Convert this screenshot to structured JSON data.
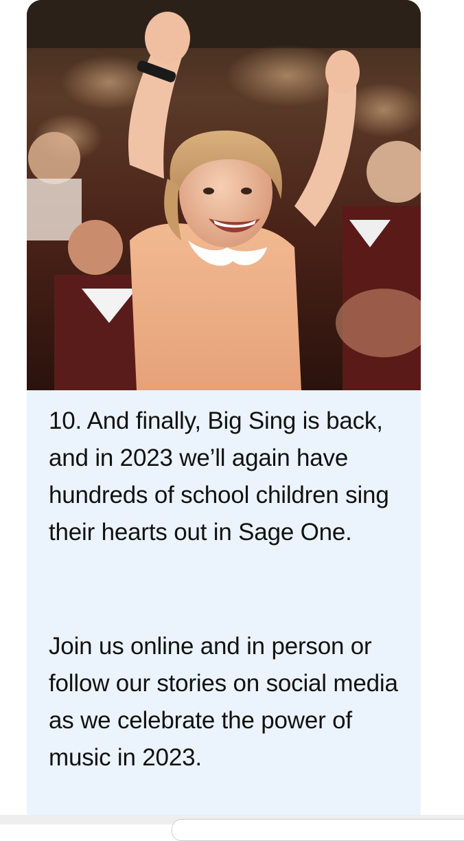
{
  "message": {
    "image": {
      "description_icon": "photo-icon"
    },
    "paragraphs": [
      "10. And finally, Big Sing is back, and in 2023 we’ll again have hundreds of school children sing their hearts out in Sage One.",
      "Join us online and in person or follow our stories on social media as we celebrate the power of music in 2023."
    ]
  },
  "colors": {
    "bubble_background": "#ebf4fc",
    "text": "#111111",
    "page_background": "#ffffff"
  }
}
